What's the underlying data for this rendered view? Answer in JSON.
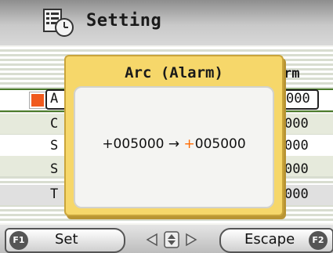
{
  "header": {
    "title": "Setting",
    "icon": "settings-clock-icon"
  },
  "list": {
    "column_right_header": "rm",
    "rows": [
      {
        "left": "A",
        "right": "000",
        "selected": true
      },
      {
        "left": "C",
        "right": "000",
        "selected": false
      },
      {
        "left": "S",
        "right": "000",
        "selected": false
      },
      {
        "left": "S",
        "right": "000",
        "selected": false
      },
      {
        "left": "T",
        "right": "000",
        "selected": false
      }
    ]
  },
  "dialog": {
    "title": "Arc (Alarm)",
    "from_value": "+005000",
    "arrow": "→",
    "to_sign": "+",
    "to_value": "005000"
  },
  "footer": {
    "f1_key": "F1",
    "f1_label": "Set",
    "f2_key": "F2",
    "f2_label": "Escape",
    "nav_icon": "navigation-arrows-icon"
  },
  "colors": {
    "accent": "#ff6a00",
    "dialog": "#f6d76a",
    "marker": "#f05a1e"
  }
}
